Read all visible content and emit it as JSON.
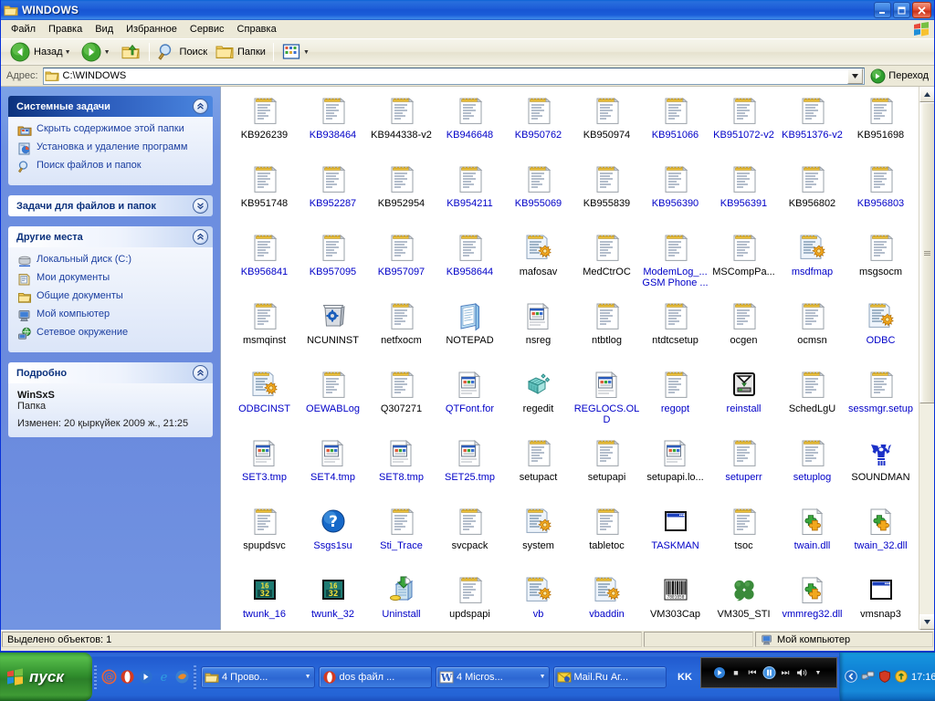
{
  "window": {
    "title": "WINDOWS",
    "icon": "folder-icon",
    "minimize_label": "_",
    "maximize_label": "❐",
    "close_label": "✕"
  },
  "menubar": {
    "items": [
      {
        "label": "Файл"
      },
      {
        "label": "Правка"
      },
      {
        "label": "Вид"
      },
      {
        "label": "Избранное"
      },
      {
        "label": "Сервис"
      },
      {
        "label": "Справка"
      }
    ]
  },
  "toolbar": {
    "back_label": "Назад",
    "forward_label": "",
    "up_label": "",
    "search_label": "Поиск",
    "folders_label": "Папки",
    "views_label": "",
    "dropdown_glyph": "▼"
  },
  "address_bar": {
    "label": "Адрес:",
    "value": "C:\\WINDOWS",
    "go_label": "Переход"
  },
  "task_pane": {
    "panels": [
      {
        "title": "Системные задачи",
        "style": "blue",
        "collapse_glyph": "«",
        "items": [
          {
            "label": "Скрыть содержимое этой папки",
            "icon": "hide-folder-icon"
          },
          {
            "label": "Установка и удаление программ",
            "icon": "add-remove-programs-icon"
          },
          {
            "label": "Поиск файлов и папок",
            "icon": "search-icon"
          }
        ]
      },
      {
        "title": "Задачи для файлов и папок",
        "style": "white",
        "collapse_glyph": "»",
        "collapsed": true,
        "items": []
      },
      {
        "title": "Другие места",
        "style": "white",
        "collapse_glyph": "«",
        "items": [
          {
            "label": "Локальный диск (C:)",
            "icon": "hard-disk-icon"
          },
          {
            "label": "Мои документы",
            "icon": "my-documents-icon"
          },
          {
            "label": "Общие документы",
            "icon": "shared-documents-icon"
          },
          {
            "label": "Мой компьютер",
            "icon": "my-computer-icon"
          },
          {
            "label": "Сетевое окружение",
            "icon": "network-places-icon"
          }
        ]
      }
    ],
    "details": {
      "title": "Подробно",
      "collapse_glyph": "«",
      "name": "WinSxS",
      "type": "Папка",
      "modified": "Изменен: 20 қыркүйек 2009 ж., 21:25"
    }
  },
  "file_list": {
    "items": [
      {
        "name": "KB926239",
        "icon": "text-file-icon",
        "color": "black"
      },
      {
        "name": "KB938464",
        "icon": "text-file-icon",
        "color": "blue"
      },
      {
        "name": "KB944338-v2",
        "icon": "text-file-icon",
        "color": "black"
      },
      {
        "name": "KB946648",
        "icon": "text-file-icon",
        "color": "blue"
      },
      {
        "name": "KB950762",
        "icon": "text-file-icon",
        "color": "blue"
      },
      {
        "name": "KB950974",
        "icon": "text-file-icon",
        "color": "black"
      },
      {
        "name": "KB951066",
        "icon": "text-file-icon",
        "color": "blue"
      },
      {
        "name": "KB951072-v2",
        "icon": "text-file-icon",
        "color": "blue"
      },
      {
        "name": "KB951376-v2",
        "icon": "text-file-icon",
        "color": "blue"
      },
      {
        "name": "KB951698",
        "icon": "text-file-icon",
        "color": "black"
      },
      {
        "name": "KB951748",
        "icon": "text-file-icon",
        "color": "black"
      },
      {
        "name": "KB952287",
        "icon": "text-file-icon",
        "color": "blue"
      },
      {
        "name": "KB952954",
        "icon": "text-file-icon",
        "color": "black"
      },
      {
        "name": "KB954211",
        "icon": "text-file-icon",
        "color": "blue"
      },
      {
        "name": "KB955069",
        "icon": "text-file-icon",
        "color": "blue"
      },
      {
        "name": "KB955839",
        "icon": "text-file-icon",
        "color": "black"
      },
      {
        "name": "KB956390",
        "icon": "text-file-icon",
        "color": "blue"
      },
      {
        "name": "KB956391",
        "icon": "text-file-icon",
        "color": "blue"
      },
      {
        "name": "KB956802",
        "icon": "text-file-icon",
        "color": "black"
      },
      {
        "name": "KB956803",
        "icon": "text-file-icon",
        "color": "blue"
      },
      {
        "name": "KB956841",
        "icon": "text-file-icon",
        "color": "blue"
      },
      {
        "name": "KB957095",
        "icon": "text-file-icon",
        "color": "blue"
      },
      {
        "name": "KB957097",
        "icon": "text-file-icon",
        "color": "blue"
      },
      {
        "name": "KB958644",
        "icon": "text-file-icon",
        "color": "blue"
      },
      {
        "name": "mafosav",
        "icon": "ini-file-icon",
        "color": "black"
      },
      {
        "name": "MedCtrOC",
        "icon": "text-file-icon",
        "color": "black"
      },
      {
        "name": "ModemLog_...\nGSM Phone ...",
        "icon": "text-file-icon",
        "color": "blue"
      },
      {
        "name": "MSCompPa...",
        "icon": "text-file-icon",
        "color": "black"
      },
      {
        "name": "msdfmap",
        "icon": "ini-file-icon",
        "color": "blue"
      },
      {
        "name": "msgsocm",
        "icon": "text-file-icon",
        "color": "black"
      },
      {
        "name": "msmqinst",
        "icon": "text-file-icon",
        "color": "black"
      },
      {
        "name": "NCUNINST",
        "icon": "uninstall-bin-icon",
        "color": "black"
      },
      {
        "name": "netfxocm",
        "icon": "text-file-icon",
        "color": "black"
      },
      {
        "name": "NOTEPAD",
        "icon": "notepad-app-icon",
        "color": "black"
      },
      {
        "name": "nsreg",
        "icon": "html-file-icon",
        "color": "black"
      },
      {
        "name": "ntbtlog",
        "icon": "text-file-icon",
        "color": "black"
      },
      {
        "name": "ntdtcsetup",
        "icon": "text-file-icon",
        "color": "black"
      },
      {
        "name": "ocgen",
        "icon": "text-file-icon",
        "color": "black"
      },
      {
        "name": "ocmsn",
        "icon": "text-file-icon",
        "color": "black"
      },
      {
        "name": "ODBC",
        "icon": "ini-file-icon",
        "color": "blue"
      },
      {
        "name": "ODBCINST",
        "icon": "ini-file-icon",
        "color": "blue"
      },
      {
        "name": "OEWABLog",
        "icon": "text-file-icon",
        "color": "blue"
      },
      {
        "name": "Q307271",
        "icon": "text-file-icon",
        "color": "black"
      },
      {
        "name": "QTFont.for",
        "icon": "html-file-icon",
        "color": "blue"
      },
      {
        "name": "regedit",
        "icon": "regedit-icon",
        "color": "black"
      },
      {
        "name": "REGLOCS.OLD",
        "icon": "html-file-icon",
        "color": "blue"
      },
      {
        "name": "regopt",
        "icon": "text-file-icon",
        "color": "blue"
      },
      {
        "name": "reinstall",
        "icon": "reinstall-icon",
        "color": "blue"
      },
      {
        "name": "SchedLgU",
        "icon": "text-file-icon",
        "color": "black"
      },
      {
        "name": "sessmgr.setup",
        "icon": "text-file-icon",
        "color": "blue"
      },
      {
        "name": "SET3.tmp",
        "icon": "html-file-icon",
        "color": "blue"
      },
      {
        "name": "SET4.tmp",
        "icon": "html-file-icon",
        "color": "blue"
      },
      {
        "name": "SET8.tmp",
        "icon": "html-file-icon",
        "color": "blue"
      },
      {
        "name": "SET25.tmp",
        "icon": "html-file-icon",
        "color": "blue"
      },
      {
        "name": "setupact",
        "icon": "text-file-icon",
        "color": "black"
      },
      {
        "name": "setupapi",
        "icon": "text-file-icon",
        "color": "black"
      },
      {
        "name": "setupapi.lo...",
        "icon": "html-file-icon",
        "color": "black"
      },
      {
        "name": "setuperr",
        "icon": "text-file-icon",
        "color": "blue"
      },
      {
        "name": "setuplog",
        "icon": "text-file-icon",
        "color": "blue"
      },
      {
        "name": "SOUNDMAN",
        "icon": "soundman-icon",
        "color": "black"
      },
      {
        "name": "spupdsvc",
        "icon": "text-file-icon",
        "color": "black"
      },
      {
        "name": "Ssgs1su",
        "icon": "help-icon",
        "color": "blue"
      },
      {
        "name": "Sti_Trace",
        "icon": "text-file-icon",
        "color": "blue"
      },
      {
        "name": "svcpack",
        "icon": "text-file-icon",
        "color": "black"
      },
      {
        "name": "system",
        "icon": "ini-file-icon",
        "color": "black"
      },
      {
        "name": "tabletoc",
        "icon": "text-file-icon",
        "color": "black"
      },
      {
        "name": "TASKMAN",
        "icon": "generic-exe-icon",
        "color": "blue"
      },
      {
        "name": "tsoc",
        "icon": "text-file-icon",
        "color": "black"
      },
      {
        "name": "twain.dll",
        "icon": "dll-file-icon",
        "color": "blue"
      },
      {
        "name": "twain_32.dll",
        "icon": "dll-file-icon",
        "color": "blue"
      },
      {
        "name": "twunk_16",
        "icon": "twunk-icon",
        "color": "blue"
      },
      {
        "name": "twunk_32",
        "icon": "twunk-icon",
        "color": "blue"
      },
      {
        "name": "Uninstall",
        "icon": "uninstall-icon",
        "color": "blue"
      },
      {
        "name": "updspapi",
        "icon": "text-file-icon",
        "color": "black"
      },
      {
        "name": "vb",
        "icon": "ini-file-icon",
        "color": "blue"
      },
      {
        "name": "vbaddin",
        "icon": "ini-file-icon",
        "color": "blue"
      },
      {
        "name": "VM303Cap",
        "icon": "barcode-icon",
        "color": "black"
      },
      {
        "name": "VM305_STI",
        "icon": "clover-icon",
        "color": "black"
      },
      {
        "name": "vmmreg32.dll",
        "icon": "dll-file-icon",
        "color": "blue"
      },
      {
        "name": "vmsnap3",
        "icon": "generic-exe-icon",
        "color": "black"
      }
    ]
  },
  "status_bar": {
    "selection_text": "Выделено объектов: 1",
    "middle_text": "",
    "location_text": "Мой компьютер"
  },
  "taskbar": {
    "start_label": "пуск",
    "quick_launch": [
      {
        "icon": "at-mail-icon"
      },
      {
        "icon": "opera-icon"
      },
      {
        "icon": "media-icon"
      },
      {
        "icon": "ie-icon"
      },
      {
        "icon": "firefox-icon"
      }
    ],
    "tasks": [
      {
        "label": "4 Прово...",
        "icon": "folder-icon",
        "has_arrow": true
      },
      {
        "label": "dos файл ...",
        "icon": "opera-icon",
        "has_arrow": false
      },
      {
        "label": "4 Micros...",
        "icon": "word-icon",
        "has_arrow": true
      },
      {
        "label": "Mail.Ru Аг...",
        "icon": "mailru-icon",
        "has_arrow": false
      }
    ],
    "language": "KK",
    "media_player": {
      "prev_glyph": "⏮",
      "stop_glyph": "■",
      "pause_glyph": "‖",
      "next_glyph": "⏭",
      "volume_glyph": "◂"
    },
    "tray": {
      "icons": [
        {
          "icon": "show-hidden-icons-chevron"
        },
        {
          "icon": "network-icon"
        },
        {
          "icon": "shield-icon"
        },
        {
          "icon": "update-arrow-icon"
        }
      ],
      "clock": "17:16"
    }
  },
  "colors": {
    "titlebar_blue": "#0831d9",
    "taskbar_blue": "#2a6adb",
    "start_green": "#3f9b35",
    "link_blue": "#1c3fa0",
    "compressed_blue": "#0000c8",
    "panel_bg": "#6d8fe0",
    "window_face": "#ece9d8"
  }
}
